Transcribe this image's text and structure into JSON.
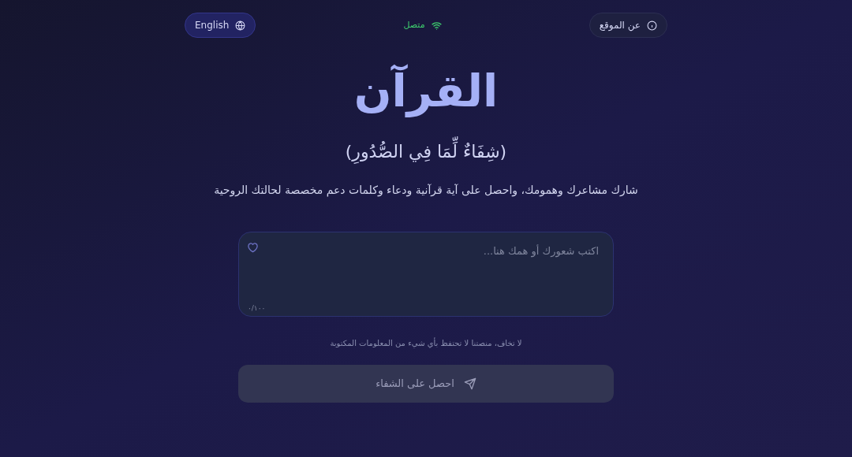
{
  "header": {
    "language_button": "English",
    "connection": {
      "label": "متصل",
      "online": true
    },
    "about_button": "عن الموقع"
  },
  "title": "القرآن",
  "subtitle": "(شِفَاءٌ لِّمَا فِي الصُّدُورِ)",
  "description": "شارك مشاعرك وهمومك، واحصل على آية قرآنية ودعاء وكلمات دعم مخصصة لحالتك الروحية",
  "input": {
    "placeholder": "اكتب شعورك أو همك هنا...",
    "counter": "٠/١٠٠"
  },
  "privacy_note": "لا تخاف، منصتنا لا تحتفظ بأي شيء من المعلومات المكتوبة",
  "submit": {
    "label": "احصل على الشفاء",
    "disabled": true
  }
}
